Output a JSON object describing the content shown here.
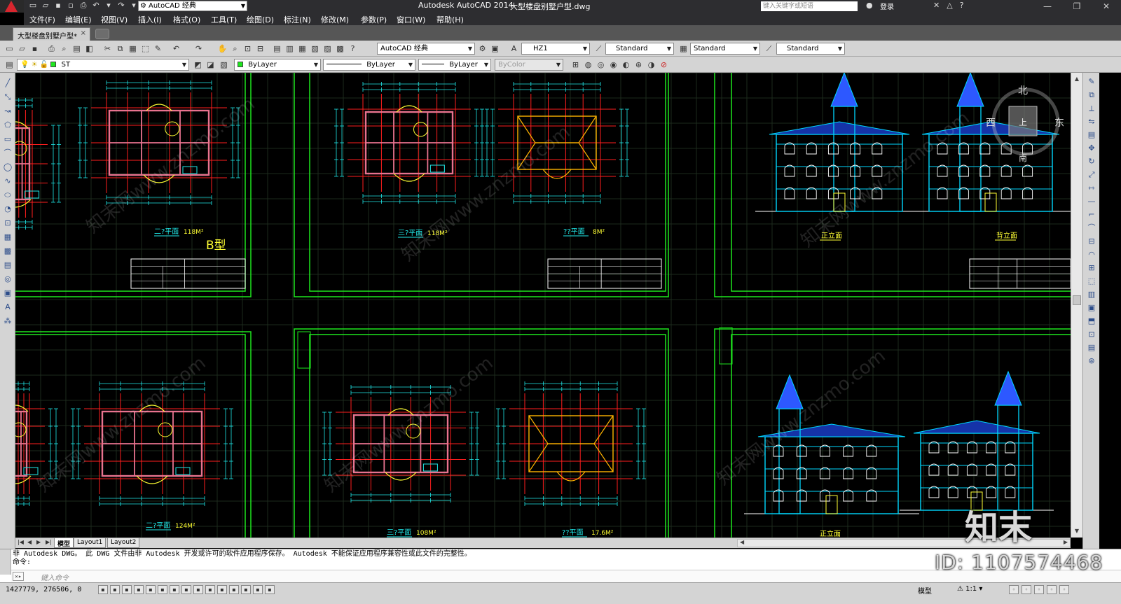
{
  "window": {
    "app_title": "Autodesk AutoCAD 2014",
    "file_title": "大型楼盘别墅户型.dwg",
    "workspace": "AutoCAD 经典",
    "search_placeholder": "键入关键字或短语",
    "login": "登录"
  },
  "menu": [
    "文件(F)",
    "编辑(E)",
    "视图(V)",
    "插入(I)",
    "格式(O)",
    "工具(T)",
    "绘图(D)",
    "标注(N)",
    "修改(M)",
    "参数(P)",
    "窗口(W)",
    "帮助(H)"
  ],
  "doc_tab": {
    "label": "大型楼盘别墅户型*",
    "close": "×"
  },
  "toolbar": {
    "workspace": "AutoCAD 经典",
    "text_style": "HZ1",
    "dim_style": "Standard",
    "table_style": "Standard",
    "mleader_style": "Standard",
    "layer": "ST",
    "color": "ByLayer",
    "linetype": "ByLayer",
    "lineweight": "ByLayer",
    "plotstyle": "ByColor"
  },
  "layout_tabs": [
    "模型",
    "Layout1",
    "Layout2"
  ],
  "command": {
    "history_line1": "非 Autodesk DWG。 此 DWG 文件由非 Autodesk 开发或许可的软件应用程序保存。 Autodesk 不能保证应用程序兼容性或此文件的完整性。",
    "history_line2": "命令:",
    "input_placeholder": "键入命令"
  },
  "status": {
    "coords": "1427779, 276506, 0",
    "model_label": "模型",
    "scale": "1:1"
  },
  "viewcube": {
    "north": "北",
    "south": "南",
    "west": "西",
    "east": "东",
    "center": "上"
  },
  "drawing": {
    "plan_labels": [
      {
        "title": "二?平面",
        "area": "118M²"
      },
      {
        "title": "三?平面",
        "area": "118M²"
      },
      {
        "title": "??平面",
        "area": "8M²"
      },
      {
        "title": "二?平面",
        "area": "124M²"
      },
      {
        "title": "三?平面",
        "area": "108M²"
      },
      {
        "title": "??平面",
        "area": "17.6M²"
      }
    ],
    "type_mark": "B型",
    "elevation_labels": [
      "正立面",
      "背立面",
      "正立面"
    ]
  },
  "watermark": {
    "brand": "知末",
    "id": "ID: 1107574468",
    "diag_text": "知末网www.znzmo.com"
  },
  "colors": {
    "canvas": "#000000",
    "frame": "#1ee61e",
    "wall": "#e8738f",
    "axis": "#ff1e1e",
    "dim": "#20e8e8",
    "label": "#ffff33",
    "roof": "#ffb300",
    "facade": "#00d8ff",
    "tower": "#2d58ff",
    "grid": "#1d2a1d"
  }
}
